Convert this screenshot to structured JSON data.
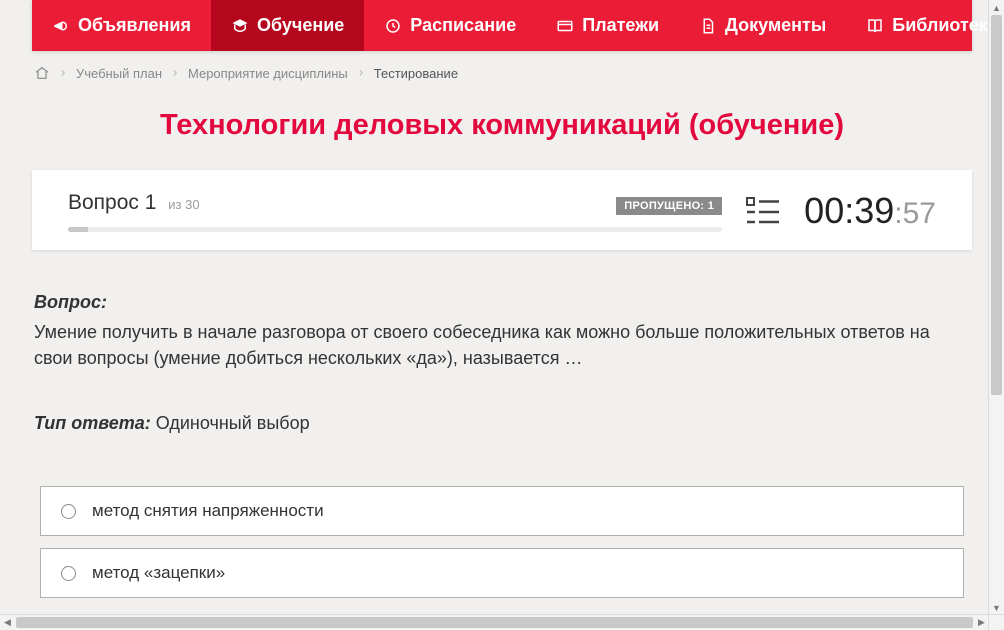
{
  "colors": {
    "navbar_bg": "#ea1c36",
    "navbar_active_bg": "#b4061c",
    "title": "#e3083d"
  },
  "nav": {
    "items": [
      {
        "label": "Объявления",
        "icon": "megaphone-icon",
        "active": false
      },
      {
        "label": "Обучение",
        "icon": "graduation-cap-icon",
        "active": true
      },
      {
        "label": "Расписание",
        "icon": "clock-icon",
        "active": false
      },
      {
        "label": "Платежи",
        "icon": "card-icon",
        "active": false
      },
      {
        "label": "Документы",
        "icon": "document-icon",
        "active": false
      },
      {
        "label": "Библиотека",
        "icon": "book-icon",
        "active": false,
        "dropdown": true
      }
    ]
  },
  "breadcrumb": {
    "home_icon": "home-icon",
    "items": [
      {
        "label": "Учебный план"
      },
      {
        "label": "Мероприятие дисциплины"
      }
    ],
    "current": "Тестирование"
  },
  "title": "Технологии деловых коммуникаций (обучение)",
  "status": {
    "question_prefix": "Вопрос",
    "question_index": "1",
    "total_prefix": "из",
    "total": "30",
    "skipped_label": "ПРОПУЩЕНО: 1",
    "timer_minutes": "00",
    "timer_seconds_major": "39",
    "timer_seconds_minor": "57"
  },
  "question": {
    "caption": "Вопрос:",
    "text": "Умение получить в начале разговора от своего собеседника как можно больше положительных ответов на свои вопросы (умение добиться нескольких «да»), называется …",
    "answer_type_label": "Тип ответа:",
    "answer_type_value": "Одиночный выбор"
  },
  "options": [
    {
      "label": "метод снятия напряженности"
    },
    {
      "label": "метод «зацепки»"
    }
  ]
}
